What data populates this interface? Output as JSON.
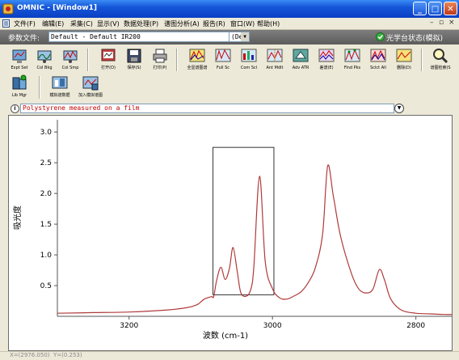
{
  "window": {
    "title": "OMNIC - [Window1]"
  },
  "menu": [
    "文件(F)",
    "编辑(E)",
    "采集(C)",
    "显示(V)",
    "数据处理(P)",
    "谱图分析(A)",
    "报告(R)",
    "窗口(W)",
    "帮助(H)"
  ],
  "params": {
    "label": "参数文件:",
    "file": "Default - Default IR200",
    "secondary": "(De",
    "status": "光学台状态(模拟)"
  },
  "toolbar": [
    {
      "label": "Expt Set",
      "icon": "experiment-setup-icon"
    },
    {
      "label": "Col Bkg",
      "icon": "collect-background-icon"
    },
    {
      "label": "Col Smp",
      "icon": "collect-sample-icon"
    },
    {
      "label": "打开(O)",
      "icon": "open-icon"
    },
    {
      "label": "保存(S)",
      "icon": "save-icon"
    },
    {
      "label": "打印(P)",
      "icon": "print-icon"
    },
    {
      "label": "全显谱图谱",
      "icon": "common-scale-icon"
    },
    {
      "label": "Full Sc",
      "icon": "full-scale-icon"
    },
    {
      "label": "Com Scl",
      "icon": "com-scale-icon"
    },
    {
      "label": "Ant Mdlt",
      "icon": "annotate-icon"
    },
    {
      "label": "Adv ATR",
      "icon": "atr-icon"
    },
    {
      "label": "差谱(E)",
      "icon": "subtract-icon"
    },
    {
      "label": "Find Pks",
      "icon": "find-peaks-icon"
    },
    {
      "label": "Sclct All",
      "icon": "select-all-icon"
    },
    {
      "label": "删除(D)",
      "icon": "delete-icon"
    },
    {
      "label": "谱图检索(S",
      "icon": "search-icon"
    },
    {
      "label": "Lib Mgr",
      "icon": "library-manager-icon"
    },
    {
      "label": "模拟谱数据",
      "icon": "simulate-data-icon"
    },
    {
      "label": "加入模拟谱图",
      "icon": "add-simulated-icon"
    }
  ],
  "spectrum": {
    "title": "Polystyrene measured on a film"
  },
  "chart_data": {
    "type": "line",
    "xlabel": "波数 (cm-1)",
    "ylabel": "吸光度",
    "xlim": [
      3300,
      2750
    ],
    "ylim": [
      0,
      3.2
    ],
    "xticks": [
      3200,
      3000,
      2800
    ],
    "yticks": [
      0.5,
      1.0,
      1.5,
      2.0,
      2.5,
      3.0
    ],
    "ytick_labels": [
      "0.5",
      "1.0",
      "1.5",
      "2.0",
      "2.5",
      "3.0"
    ],
    "series": [
      {
        "color": "#B03A3A",
        "x": [
          3300,
          3250,
          3200,
          3150,
          3120,
          3105,
          3095,
          3085,
          3082,
          3078,
          3072,
          3066,
          3060,
          3055,
          3049,
          3044,
          3036,
          3030,
          3026,
          3018,
          3010,
          3000,
          2990,
          2980,
          2970,
          2960,
          2950,
          2940,
          2930,
          2923,
          2915,
          2905,
          2890,
          2880,
          2870,
          2860,
          2851,
          2844,
          2835,
          2820,
          2800,
          2780,
          2760,
          2750
        ],
        "y": [
          0.05,
          0.06,
          0.07,
          0.1,
          0.14,
          0.19,
          0.28,
          0.32,
          0.32,
          0.58,
          0.8,
          0.6,
          0.78,
          1.12,
          0.72,
          0.38,
          0.33,
          0.45,
          0.8,
          2.28,
          0.88,
          0.45,
          0.3,
          0.28,
          0.33,
          0.4,
          0.55,
          0.8,
          1.35,
          2.45,
          1.95,
          1.3,
          0.7,
          0.45,
          0.38,
          0.44,
          0.76,
          0.6,
          0.28,
          0.1,
          0.05,
          0.04,
          0.03,
          0.03
        ]
      }
    ],
    "selection_box": {
      "x": [
        3083,
        2998
      ],
      "y": [
        0.35,
        2.75
      ]
    }
  },
  "statusbar": {
    "coords": "X=(2976.050)  Y=(0.253)"
  }
}
